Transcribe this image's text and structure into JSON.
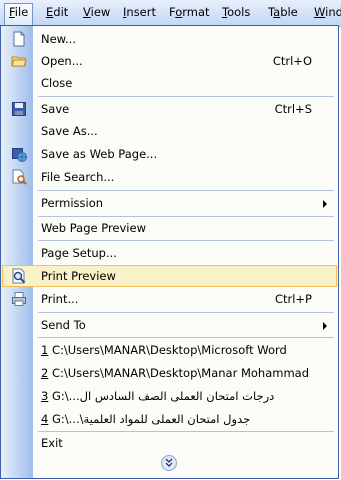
{
  "menubar": {
    "items": [
      {
        "label": "File",
        "underline": "F"
      },
      {
        "label": "Edit",
        "underline": "E"
      },
      {
        "label": "View",
        "underline": "V"
      },
      {
        "label": "Insert",
        "underline": "I"
      },
      {
        "label": "Format",
        "underline": "o"
      },
      {
        "label": "Tools",
        "underline": "T"
      },
      {
        "label": "Table",
        "underline": "a"
      },
      {
        "label": "Wind",
        "underline": "W"
      }
    ]
  },
  "file_menu": {
    "new": "New...",
    "open": "Open...",
    "open_shortcut": "Ctrl+O",
    "close": "Close",
    "save": "Save",
    "save_shortcut": "Ctrl+S",
    "save_as": "Save As...",
    "save_web": "Save as Web Page...",
    "file_search": "File Search...",
    "permission": "Permission",
    "web_preview": "Web Page Preview",
    "page_setup": "Page Setup...",
    "print_preview": "Print Preview",
    "print": "Print...",
    "print_shortcut": "Ctrl+P",
    "send_to": "Send To",
    "recent_files": [
      {
        "num": "1",
        "path": "C:\\Users\\MANAR\\Desktop\\Microsoft Word"
      },
      {
        "num": "2",
        "path": "C:\\Users\\MANAR\\Desktop\\Manar Mohammad"
      },
      {
        "num": "3",
        "path": "G:\\...درجات امتحان العملى الصف السادس ال"
      },
      {
        "num": "4",
        "path": "G:\\...\\جدول امتحان العملى للمواد العلمية"
      }
    ],
    "exit": "Exit"
  },
  "colors": {
    "menu_border": "#3d5ea8",
    "highlight_bg": "#fbf1c7",
    "highlight_border": "#f0be5c",
    "gutter_start": "#eaf1fc",
    "gutter_end": "#9ebdeb"
  }
}
